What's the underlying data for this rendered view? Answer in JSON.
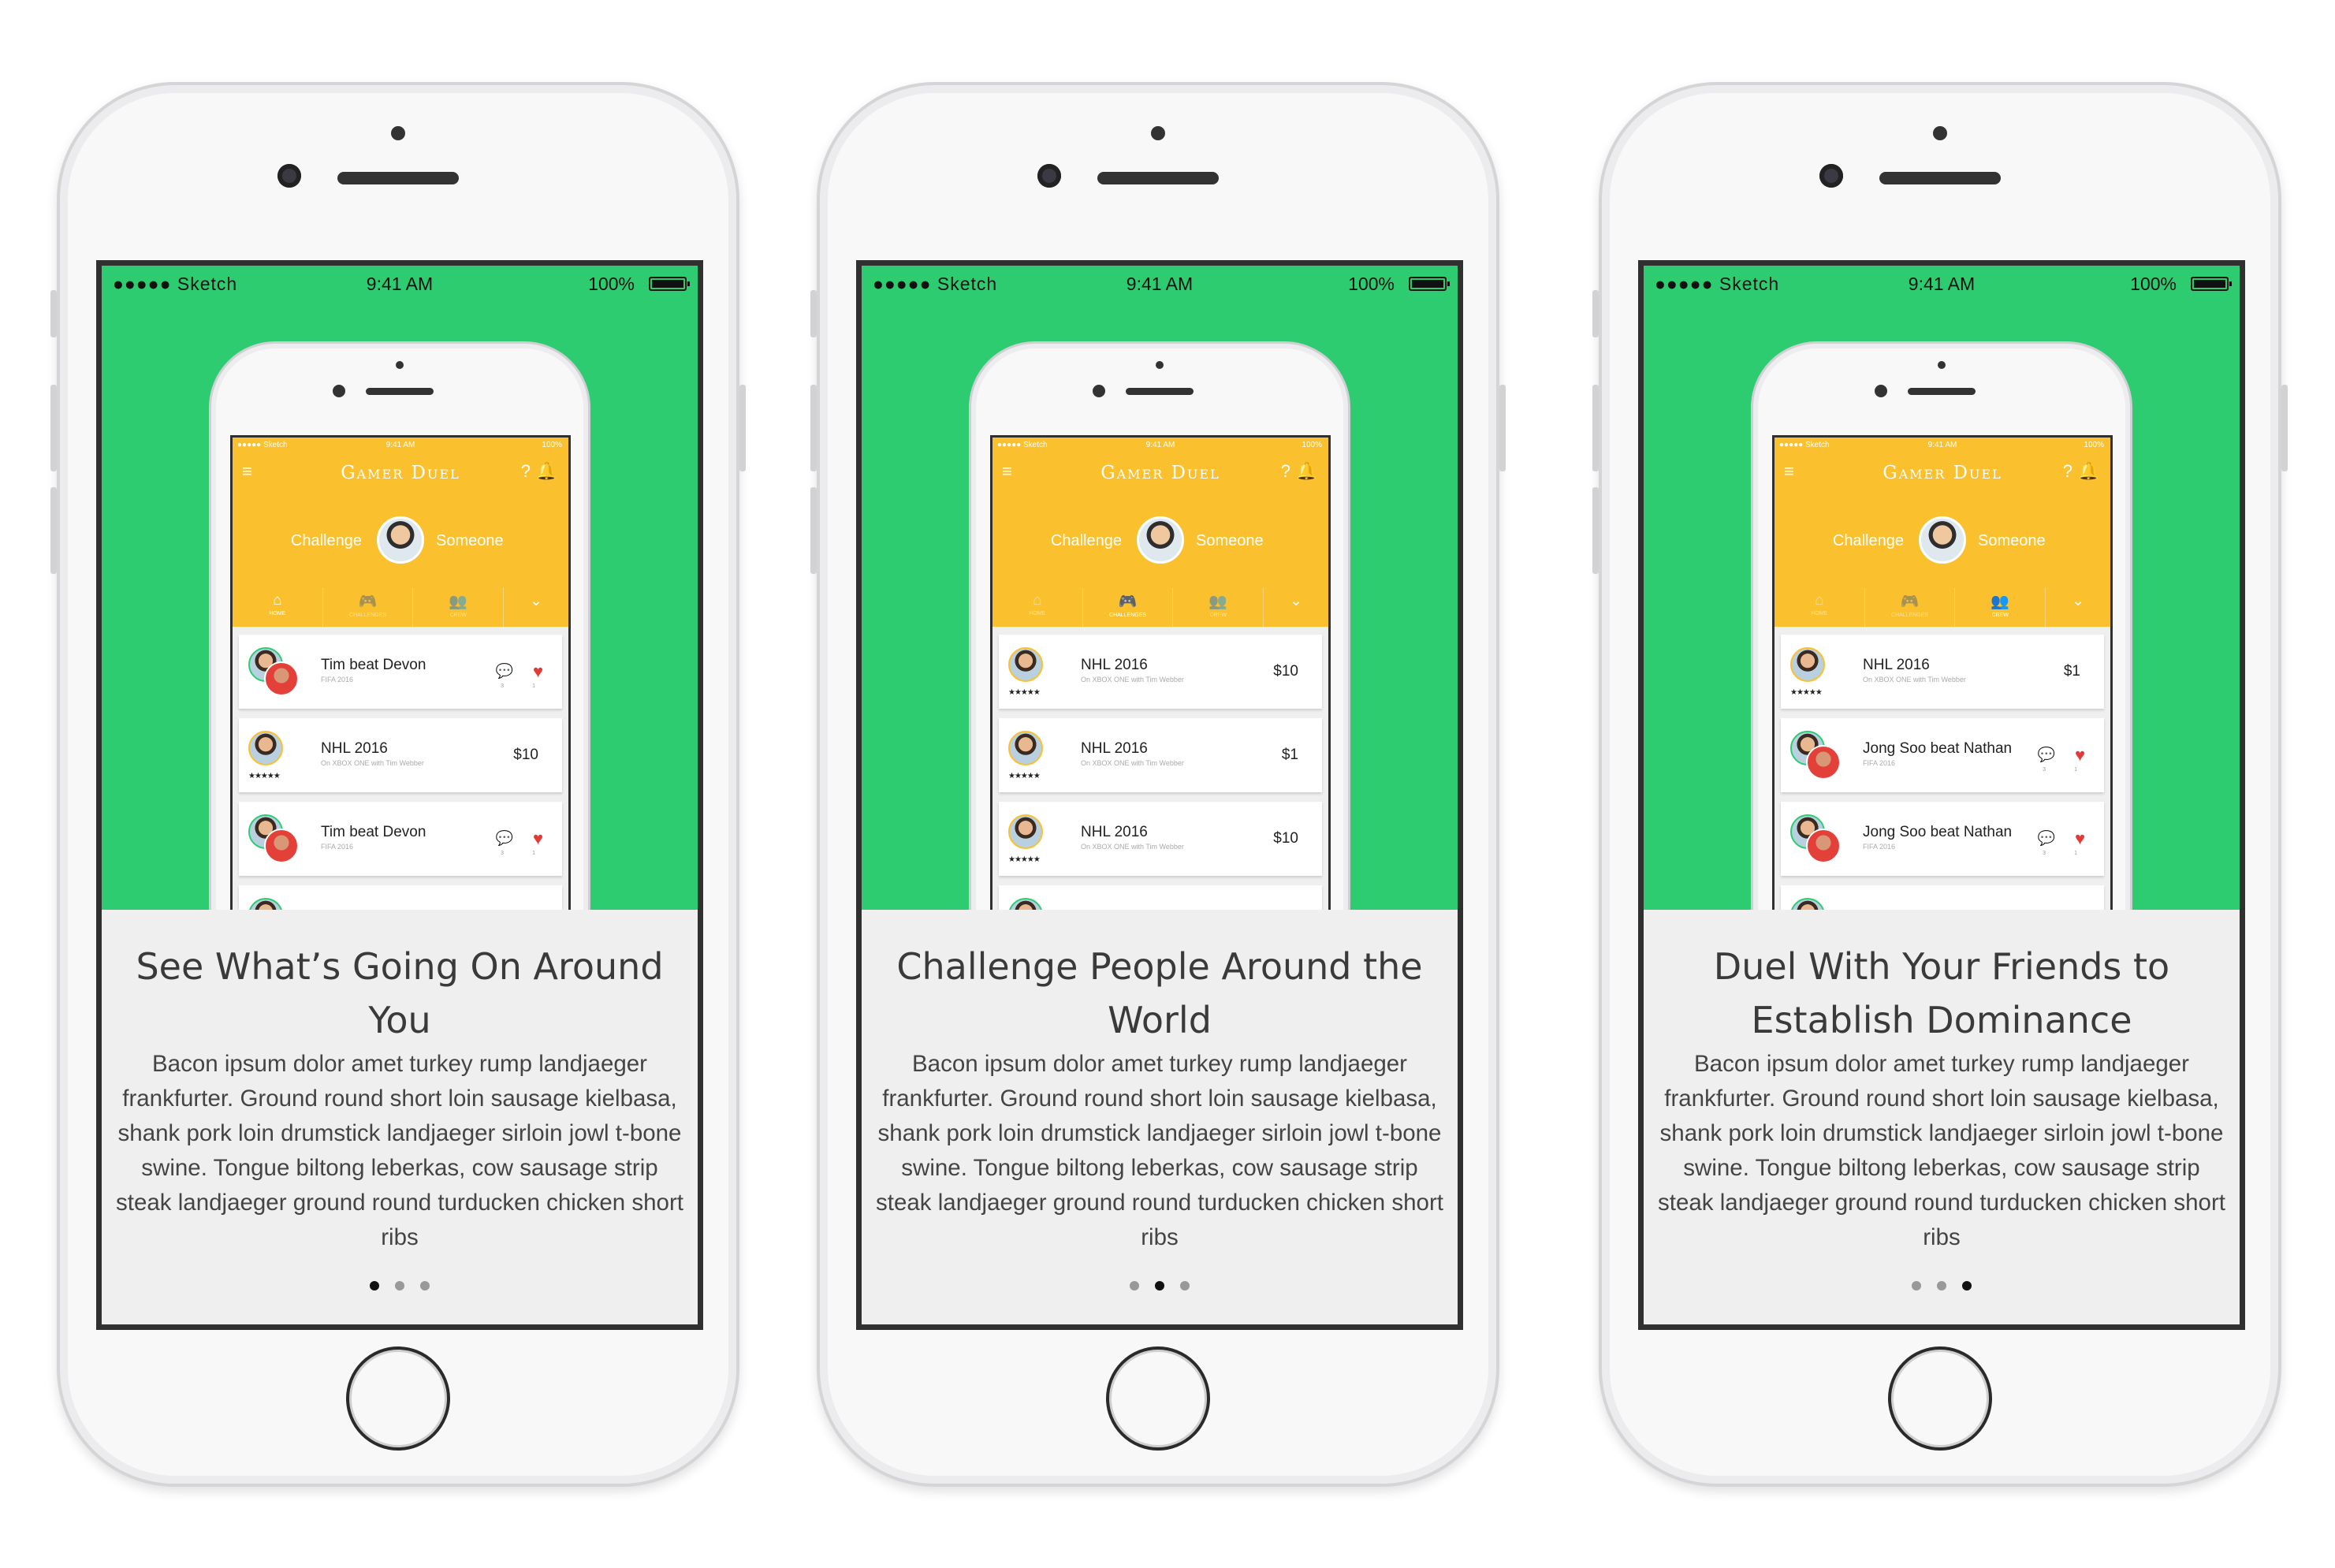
{
  "common": {
    "status": {
      "carrier": "●●●●● Sketch",
      "time": "9:41 AM",
      "battery": "100%"
    },
    "inner_status": {
      "carrier": "●●●●● Sketch",
      "time": "9:41 AM",
      "battery": "100%"
    },
    "app_title": "Gamer Duel",
    "challenge_left": "Challenge",
    "challenge_right": "Someone",
    "body": "Bacon ipsum dolor amet turkey rump landjaeger frankfurter. Ground round short loin sausage kielbasa, shank pork loin drumstick landjaeger sirloin jowl t-bone swine. Tongue biltong leberkas, cow sausage strip steak landjaeger ground round turducken chicken short ribs",
    "tabs": [
      "HOME",
      "CHALLENGES",
      "CREW"
    ],
    "colors": {
      "green": "#2ecc71",
      "yellow": "#fbc02d",
      "heart": "#e53935"
    }
  },
  "screens": [
    {
      "title": "See What’s Going On Around You",
      "active_dot": 0,
      "active_tab": 0,
      "cards": [
        {
          "kind": "duel",
          "title": "Tim beat Devon",
          "sub": "FIFA 2016",
          "chat_count": "3",
          "like_count": "1"
        },
        {
          "kind": "bet",
          "title": "NHL 2016",
          "sub": "On XBOX ONE with Tim Webber",
          "amount": "$10"
        },
        {
          "kind": "duel",
          "title": "Tim beat Devon",
          "sub": "FIFA 2016",
          "chat_count": "3",
          "like_count": "1"
        }
      ]
    },
    {
      "title": "Challenge People Around the World",
      "active_dot": 1,
      "active_tab": 1,
      "cards": [
        {
          "kind": "bet",
          "title": "NHL 2016",
          "sub": "On XBOX ONE with Tim Webber",
          "amount": "$10"
        },
        {
          "kind": "bet",
          "title": "NHL 2016",
          "sub": "On XBOX ONE with Tim Webber",
          "amount": "$1"
        },
        {
          "kind": "bet",
          "title": "NHL 2016",
          "sub": "On XBOX ONE with Tim Webber",
          "amount": "$10"
        }
      ]
    },
    {
      "title": "Duel With Your Friends to Establish Dominance",
      "active_dot": 2,
      "active_tab": 2,
      "cards": [
        {
          "kind": "bet",
          "title": "NHL 2016",
          "sub": "On XBOX ONE with Tim Webber",
          "amount": "$1"
        },
        {
          "kind": "duel",
          "title": "Jong Soo beat Nathan",
          "sub": "FIFA 2016",
          "chat_count": "3",
          "like_count": "1"
        },
        {
          "kind": "duel",
          "title": "Jong Soo beat Nathan",
          "sub": "FIFA 2016",
          "chat_count": "3",
          "like_count": "1"
        }
      ]
    }
  ]
}
